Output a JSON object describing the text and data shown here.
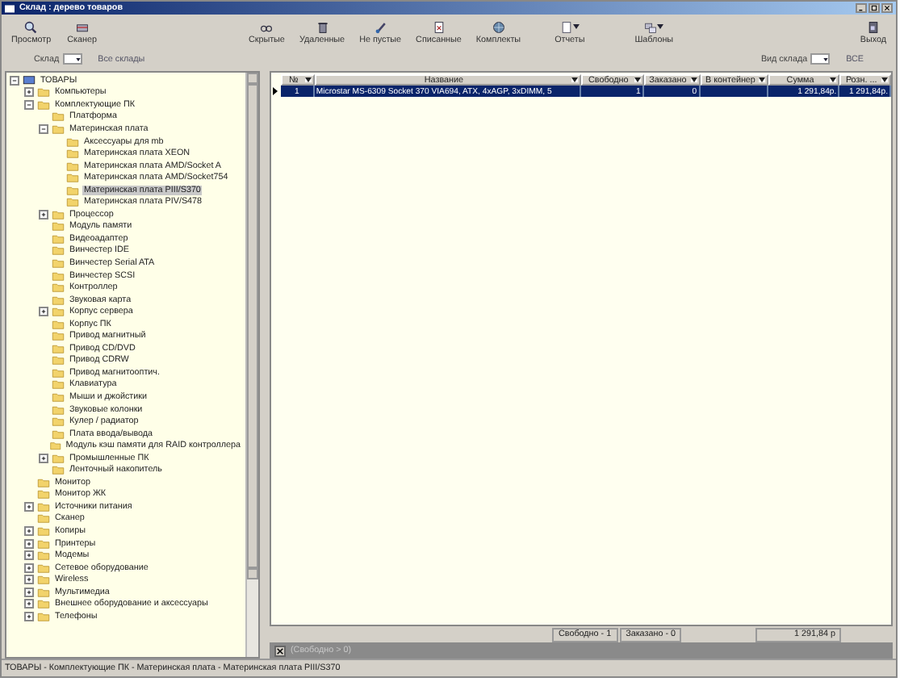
{
  "window": {
    "title": "Склад : дерево товаров"
  },
  "toolbar": {
    "left": [
      {
        "label": "Просмотр",
        "dropdown": false
      },
      {
        "label": "Сканер",
        "dropdown": false
      }
    ],
    "middle": [
      {
        "label": "Скрытые",
        "dropdown": false
      },
      {
        "label": "Удаленные",
        "dropdown": false
      },
      {
        "label": "Не пустые",
        "dropdown": false
      },
      {
        "label": "Списанные",
        "dropdown": false
      },
      {
        "label": "Комплекты",
        "dropdown": false
      },
      {
        "label": "Отчеты",
        "dropdown": true
      },
      {
        "label": "Шаблоны",
        "dropdown": true
      }
    ],
    "right": [
      {
        "label": "Выход",
        "dropdown": false
      }
    ]
  },
  "filters": {
    "warehouse_label": "Склад",
    "warehouse_value": "Все склады",
    "type_label": "Вид склада",
    "type_value": "ВСЕ"
  },
  "tree": [
    {
      "label": "ТОВАРЫ",
      "expanded": true,
      "selected": false,
      "children": [
        {
          "label": "Компьютеры",
          "expanded": false,
          "selected": false
        },
        {
          "label": "Комплектующие ПК",
          "expanded": true,
          "selected": false,
          "children": [
            {
              "label": "Платформа",
              "selected": false
            },
            {
              "label": "Материнская плата",
              "expanded": true,
              "selected": false,
              "children": [
                {
                  "label": "Аксессуары для mb",
                  "selected": false
                },
                {
                  "label": "Материнская плата XEON",
                  "selected": false
                },
                {
                  "label": "Материнская плата AMD/Socket A",
                  "selected": false
                },
                {
                  "label": "Материнская плата AMD/Socket754",
                  "selected": false
                },
                {
                  "label": "Материнская плата PIII/S370",
                  "selected": true
                },
                {
                  "label": "Материнская плата PIV/S478",
                  "selected": false
                }
              ]
            },
            {
              "label": "Процессор",
              "expanded": false,
              "selected": false
            },
            {
              "label": "Модуль памяти",
              "selected": false
            },
            {
              "label": "Видеоадаптер",
              "selected": false
            },
            {
              "label": "Винчестер IDE",
              "selected": false
            },
            {
              "label": "Винчестер Serial ATA",
              "selected": false
            },
            {
              "label": "Винчестер SCSI",
              "selected": false
            },
            {
              "label": "Контроллер",
              "selected": false
            },
            {
              "label": "Звуковая карта",
              "selected": false
            },
            {
              "label": "Корпус сервера",
              "expanded": false,
              "selected": false
            },
            {
              "label": "Корпус ПК",
              "selected": false
            },
            {
              "label": "Привод магнитный",
              "selected": false
            },
            {
              "label": "Привод CD/DVD",
              "selected": false
            },
            {
              "label": "Привод CDRW",
              "selected": false
            },
            {
              "label": "Привод магнитооптич.",
              "selected": false
            },
            {
              "label": "Клавиатура",
              "selected": false
            },
            {
              "label": "Мыши и джойстики",
              "selected": false
            },
            {
              "label": "Звуковые колонки",
              "selected": false
            },
            {
              "label": "Кулер / радиатор",
              "selected": false
            },
            {
              "label": "Плата ввода/вывода",
              "selected": false
            },
            {
              "label": "Модуль кэш памяти для RAID контроллера",
              "selected": false
            },
            {
              "label": "Промышленные ПК",
              "expanded": false,
              "selected": false
            },
            {
              "label": "Ленточный накопитель",
              "selected": false
            }
          ]
        },
        {
          "label": "Монитор",
          "selected": false
        },
        {
          "label": "Монитор ЖК",
          "selected": false
        },
        {
          "label": "Источники питания",
          "expanded": false,
          "selected": false
        },
        {
          "label": "Сканер",
          "selected": false
        },
        {
          "label": "Копиры",
          "expanded": false,
          "selected": false
        },
        {
          "label": "Принтеры",
          "expanded": false,
          "selected": false
        },
        {
          "label": "Модемы",
          "expanded": false,
          "selected": false
        },
        {
          "label": "Сетевое оборудование",
          "expanded": false,
          "selected": false
        },
        {
          "label": "Wireless",
          "expanded": false,
          "selected": false
        },
        {
          "label": "Мультимедиа",
          "expanded": false,
          "selected": false
        },
        {
          "label": "Внешнее оборудование и аксессуары",
          "expanded": false,
          "selected": false
        },
        {
          "label": "Телефоны",
          "expanded": false,
          "selected": false
        }
      ]
    }
  ],
  "table": {
    "columns": [
      {
        "label": "№"
      },
      {
        "label": "Название"
      },
      {
        "label": "Свободно"
      },
      {
        "label": "Заказано"
      },
      {
        "label": "В контейнер"
      },
      {
        "label": "Сумма"
      },
      {
        "label": "Розн. ..."
      }
    ],
    "rows": [
      {
        "selected": true,
        "cells": [
          "1",
          "Microstar MS-6309 Socket 370 VIA694, ATX, 4xAGP, 3xDIMM, 5",
          "1",
          "0",
          "",
          "1 291,84р.",
          "1 291,84р."
        ]
      }
    ]
  },
  "totals": {
    "free": "Свободно - 1",
    "ordered": "Заказано - 0",
    "sum": "1 291,84 р"
  },
  "filter_bar": {
    "checked": true,
    "text": "(Свободно > 0)"
  },
  "status_bar": "ТОВАРЫ - Комплектующие ПК - Материнская плата - Материнская плата PIII/S370"
}
